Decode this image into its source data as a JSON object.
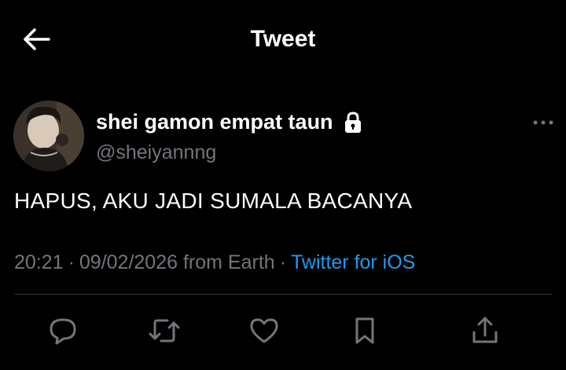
{
  "header": {
    "title": "Tweet",
    "back_icon": "arrow-left-icon"
  },
  "author": {
    "display_name": "shei gamon empat taun",
    "handle": "@sheiyannng",
    "protected_icon": "lock-icon",
    "more_icon": "more-horizontal-icon"
  },
  "tweet": {
    "text": "HAPUS, AKU JADI SUMALA BACANYA",
    "time": "20:21",
    "date": "09/02/2026",
    "location": "from Earth",
    "separator": "·",
    "source": "Twitter for iOS"
  },
  "actions": {
    "reply_icon": "reply-icon",
    "retweet_icon": "retweet-icon",
    "like_icon": "heart-icon",
    "bookmark_icon": "bookmark-icon",
    "share_icon": "share-icon"
  },
  "colors": {
    "background": "#000000",
    "primary_text": "#ffffff",
    "secondary_text": "#71767b",
    "accent": "#1d9bf0",
    "divider": "#2f3336"
  }
}
